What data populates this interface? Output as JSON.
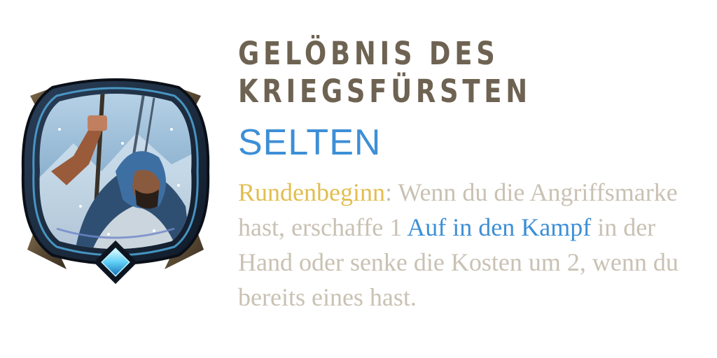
{
  "card": {
    "title_line1": "GELÖBNIS DES",
    "title_line2": "KRIEGSFÜRSTEN",
    "rarity": "SELTEN",
    "description": {
      "keyword": "Rundenbeginn",
      "colon": ":",
      "text_1": " Wenn du die Angriffsmarke hast, erschaffe 1 ",
      "card_link": "Auf in den Kampf",
      "text_2": " in der Hand oder senke die Kosten um 2, wenn du bereits eines hast."
    },
    "icon": "warrior-portrait-icon",
    "gem_icon": "blue-gem-icon"
  },
  "colors": {
    "title": "#6e6352",
    "rarity": "#3d8fd6",
    "body_text": "#c9c1b3",
    "keyword": "#e2be4e",
    "card_link": "#3d8fd6"
  }
}
